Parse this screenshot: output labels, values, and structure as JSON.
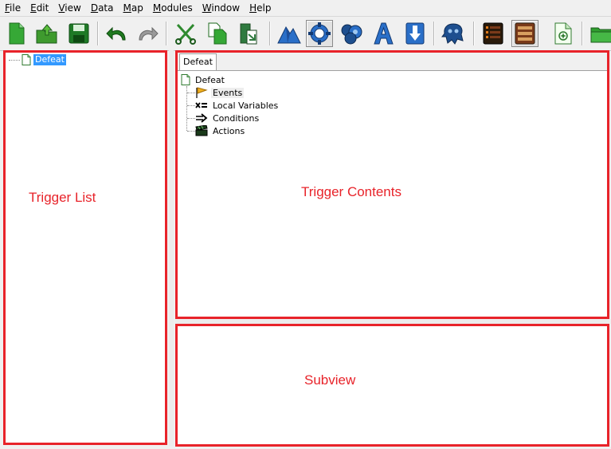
{
  "menu": [
    "File",
    "Edit",
    "View",
    "Data",
    "Map",
    "Modules",
    "Window",
    "Help"
  ],
  "toolbar": {
    "buttons": [
      {
        "icon": "new-document-icon",
        "color": "#2f9e2f"
      },
      {
        "icon": "open-folder-icon",
        "color": "#3e9a2e"
      },
      {
        "icon": "save-disk-icon",
        "color": "#1e7a26"
      },
      {
        "icon": "undo-arrow-icon",
        "color": "#1f7a1f"
      },
      {
        "icon": "redo-arrow-icon",
        "color": "#9a9a9a"
      },
      {
        "icon": "cut-scissors-icon",
        "color": "#2f8a2f"
      },
      {
        "icon": "copy-icon",
        "color": "#2f9e2f"
      },
      {
        "icon": "paste-icon",
        "color": "#2f7a3f"
      },
      {
        "icon": "terrain-module-icon",
        "color": "#2a6fc8"
      },
      {
        "icon": "trigger-module-icon",
        "color": "#2a6fc8"
      },
      {
        "icon": "data-module-icon",
        "color": "#1e4f8f"
      },
      {
        "icon": "text-module-icon",
        "color": "#2a6fc8"
      },
      {
        "icon": "import-module-icon",
        "color": "#2a6fc8"
      },
      {
        "icon": "cutscene-module-icon",
        "color": "#1e4f8f"
      },
      {
        "icon": "list-module-icon",
        "color": "#7a3a1a"
      },
      {
        "icon": "list-module-alt-icon",
        "color": "#7a3a1a"
      },
      {
        "icon": "script-document-icon",
        "color": "#2f9e2f"
      },
      {
        "icon": "folder-icon",
        "color": "#2f9e2f"
      }
    ]
  },
  "trigger_list": {
    "root_label": "Defeat"
  },
  "trigger_contents": {
    "tab_label": "Defeat",
    "root_label": "Defeat",
    "children": [
      {
        "label": "Events",
        "icon": "flag-icon"
      },
      {
        "label": "Local Variables",
        "icon": "variable-icon"
      },
      {
        "label": "Conditions",
        "icon": "condition-arrow-icon"
      },
      {
        "label": "Actions",
        "icon": "clapper-icon"
      }
    ]
  },
  "annotations": {
    "trigger_list": "Trigger List",
    "trigger_contents": "Trigger Contents",
    "subview": "Subview"
  },
  "colors": {
    "annotation_red": "#e8232a",
    "selection_blue": "#3399ff"
  }
}
